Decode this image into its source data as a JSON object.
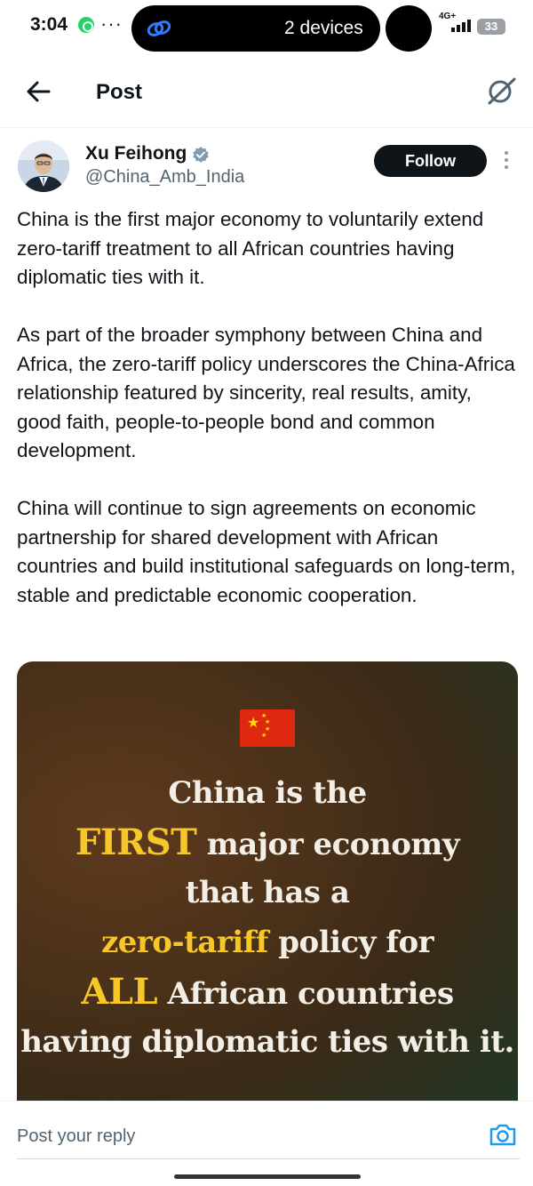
{
  "status_bar": {
    "time": "3:04",
    "dots": "···",
    "island_label": "2 devices",
    "network": "4G+",
    "battery": "33"
  },
  "header": {
    "title": "Post",
    "back_icon": "arrow-left-icon",
    "grok_icon": "grok-icon"
  },
  "author": {
    "name": "Xu Feihong",
    "handle": "@China_Amb_India",
    "verified_color": "#829aab",
    "follow_label": "Follow"
  },
  "post": {
    "paragraphs": [
      "China is the first major economy to voluntarily extend zero-tariff treatment to all African countries having diplomatic ties with it.",
      "As part of the broader symphony between China and Africa, the zero-tariff policy underscores the China-Africa relationship featured by sincerity, real results, amity, good faith, people-to-people bond and common development.",
      "China will continue to sign agreements on economic partnership for shared development with African countries and build institutional safeguards on long-term, stable and predictable economic cooperation."
    ]
  },
  "media": {
    "flag_icon": "china-flag-icon",
    "line1": "China is the",
    "line2_highlight": "FIRST",
    "line2_rest": " major economy",
    "line3": "that has a",
    "line4_highlight": "zero-tariff",
    "line4_rest": " policy for",
    "line5_highlight": "ALL",
    "line5_rest": " African countries",
    "line6": "having diplomatic ties with it.",
    "highlight_color": "#f7c628"
  },
  "reply": {
    "placeholder": "Post your reply",
    "camera_icon": "camera-icon",
    "accent_color": "#1d9bf0"
  }
}
